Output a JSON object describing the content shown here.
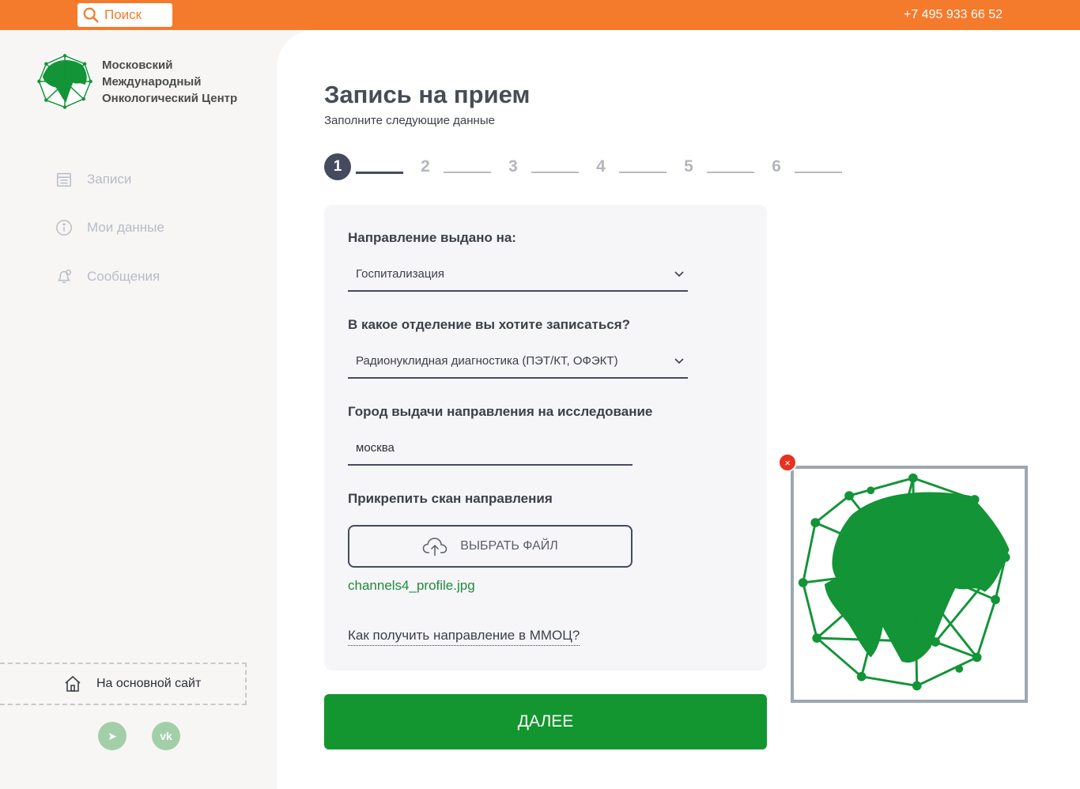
{
  "topbar": {
    "search": {
      "placeholder": "Поиск",
      "icon": "search-icon"
    },
    "phone": "+7 495 933 66 52",
    "color": "#f47a2c"
  },
  "sidebar": {
    "logo": {
      "line1": "Московский",
      "line2": "Международный",
      "line3": "Онкологический Центр"
    },
    "nav": [
      {
        "label": "Записи",
        "icon": "calendar-icon"
      },
      {
        "label": "Мои данные",
        "icon": "info-icon"
      },
      {
        "label": "Сообщения",
        "icon": "bell-icon"
      }
    ],
    "main_site": {
      "label": "На основной сайт",
      "icon": "home-icon"
    },
    "social": [
      {
        "name": "telegram-icon",
        "glyph": "➤"
      },
      {
        "name": "vk-icon",
        "glyph": "vk"
      }
    ]
  },
  "form": {
    "title": "Запись на прием",
    "subtitle": "Заполните следующие данные",
    "steps": [
      "1",
      "2",
      "3",
      "4",
      "5",
      "6"
    ],
    "current_step": 1,
    "referral_label": "Направление выдано на:",
    "referral_value": "Госпитализация",
    "department_label": "В какое отделение вы хотите записаться?",
    "department_value": "Радионуклидная диагностика (ПЭТ/КТ, ОФЭКТ)",
    "city_label": "Город выдачи направления на исследование",
    "city_value": "москва",
    "attach_label": "Прикрепить скан направления",
    "file_button": "ВЫБРАТЬ ФАЙЛ",
    "file_name": "channels4_profile.jpg",
    "help_link": "Как получить направление в ММОЦ?",
    "next_button": "ДАЛЕЕ"
  },
  "preview": {
    "close_glyph": "×"
  },
  "colors": {
    "accent": "#13962f",
    "dark": "#464a5e",
    "danger": "#e8311f"
  }
}
